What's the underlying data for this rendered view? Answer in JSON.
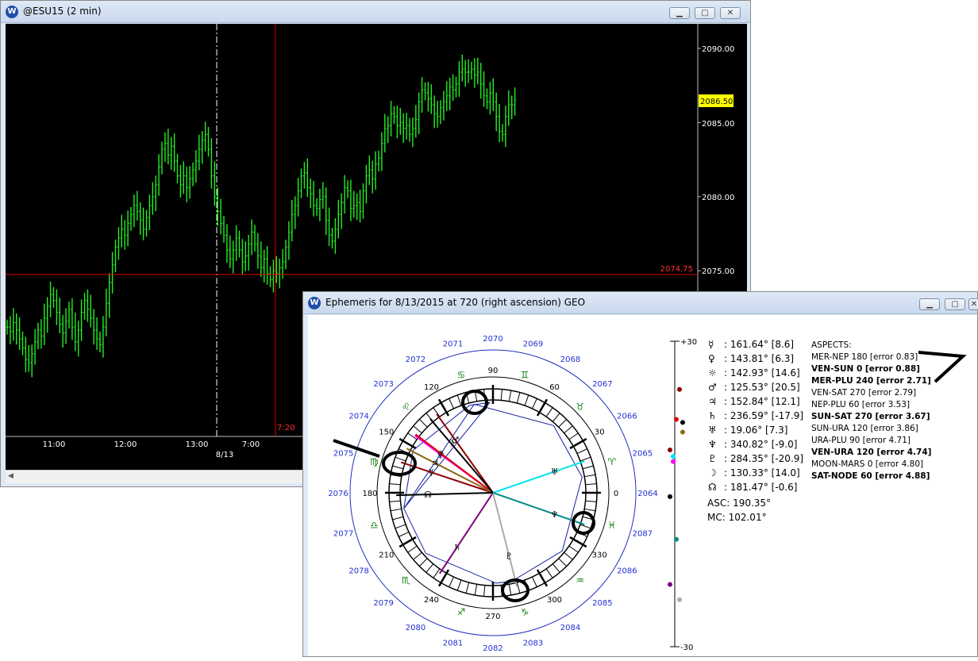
{
  "chart_window": {
    "title": "@ESU15 (2 min)",
    "icon": "w-logo-icon",
    "last_price": "2086.50",
    "crosshair_price": "2074.75",
    "crosshair_time": "7:20",
    "x_ticks": [
      "11:00",
      "12:00",
      "13:00",
      "7:00"
    ],
    "date_label": "8/13",
    "y_ticks": [
      "2090.00",
      "2085.00",
      "2080.00",
      "2075.00"
    ]
  },
  "chart_data": {
    "type": "bar",
    "title": "@ESU15 (2 min)",
    "ylim": [
      2070.0,
      2091.5
    ],
    "y_ticks": [
      2090.0,
      2085.0,
      2080.0,
      2075.0
    ],
    "x_ticks": [
      "11:00",
      "12:00",
      "13:00",
      "7:00"
    ],
    "last_price": 2086.5,
    "crosshair_price": 2074.75,
    "values": [
      2071.2,
      2070.9,
      2071.5,
      2071.0,
      2070.4,
      2069.8,
      2069.0,
      2068.8,
      2069.4,
      2070.2,
      2071.0,
      2070.6,
      2071.8,
      2072.6,
      2073.4,
      2073.0,
      2072.2,
      2071.4,
      2070.8,
      2071.6,
      2072.4,
      2071.2,
      2070.2,
      2071.0,
      2072.2,
      2073.0,
      2072.4,
      2071.8,
      2071.0,
      2070.4,
      2070.0,
      2071.2,
      2072.8,
      2074.2,
      2075.4,
      2076.6,
      2077.2,
      2077.8,
      2077.4,
      2078.2,
      2078.8,
      2079.4,
      2079.0,
      2078.4,
      2077.8,
      2078.6,
      2079.4,
      2080.0,
      2080.8,
      2082.0,
      2083.2,
      2083.6,
      2082.8,
      2083.4,
      2082.4,
      2081.4,
      2080.8,
      2081.4,
      2080.6,
      2081.2,
      2081.8,
      2082.4,
      2083.2,
      2083.8,
      2084.2,
      2083.2,
      2081.4,
      2080.0,
      2079.0,
      2078.2,
      2077.4,
      2076.4,
      2075.8,
      2076.4,
      2077.2,
      2076.4,
      2075.6,
      2076.0,
      2076.8,
      2077.6,
      2076.8,
      2076.0,
      2075.2,
      2075.8,
      2074.8,
      2074.4,
      2075.0,
      2074.8,
      2075.2,
      2075.6,
      2076.6,
      2077.6,
      2078.8,
      2079.4,
      2080.4,
      2081.4,
      2081.6,
      2080.6,
      2080.2,
      2079.4,
      2079.2,
      2079.8,
      2080.0,
      2078.4,
      2077.4,
      2077.0,
      2077.8,
      2078.8,
      2079.6,
      2080.6,
      2080.4,
      2079.2,
      2079.4,
      2079.6,
      2079.0,
      2080.4,
      2081.4,
      2081.8,
      2081.2,
      2082.2,
      2082.6,
      2083.6,
      2084.6,
      2084.8,
      2085.6,
      2085.4,
      2084.8,
      2085.0,
      2084.6,
      2084.8,
      2084.2,
      2084.6,
      2085.2,
      2086.4,
      2087.2,
      2087.0,
      2086.6,
      2086.2,
      2085.6,
      2085.4,
      2086.0,
      2086.4,
      2086.8,
      2087.4,
      2087.2,
      2087.6,
      2088.4,
      2088.6,
      2088.4,
      2088.4,
      2088.6,
      2088.2,
      2088.4,
      2087.6,
      2086.8,
      2086.4,
      2087.0,
      2086.4,
      2085.4,
      2084.4,
      2084.2,
      2085.4,
      2086.2,
      2086.2,
      2086.5
    ]
  },
  "ephemeris_window": {
    "title": "Ephemeris for 8/13/2015 at 720 (right ascension) GEO",
    "icon": "w-logo-icon",
    "wheel": {
      "outer_labels": [
        "2070",
        "2069",
        "2068",
        "2067",
        "2066",
        "2065",
        "2064",
        "2087",
        "2086",
        "2085",
        "2084",
        "2083",
        "2082",
        "2081",
        "2080",
        "2079",
        "2078",
        "2077",
        "2076",
        "2075",
        "2074",
        "2073",
        "2072",
        "2071"
      ],
      "degree_labels": [
        "90",
        "60",
        "30",
        "0",
        "330",
        "300",
        "270",
        "240",
        "210",
        "180",
        "150",
        "120"
      ],
      "sign_glyphs": [
        "♈",
        "♉",
        "♊",
        "♋",
        "♌",
        "♍",
        "♎",
        "♏",
        "♐",
        "♑",
        "♒",
        "♓"
      ]
    },
    "declination_scale": {
      "top": "+30",
      "bottom": "-30"
    },
    "planets": [
      {
        "glyph": "☿",
        "text": ": 161.64° [8.6]",
        "color": "#8b0000",
        "angle": 161.64,
        "decl": 8.6
      },
      {
        "glyph": "♀",
        "text": ": 143.81° [6.3]",
        "color": "#ff00ff",
        "angle": 143.81,
        "decl": 6.3
      },
      {
        "glyph": "☼",
        "text": ": 142.93° [14.6]",
        "color": "#dd0000",
        "angle": 142.93,
        "decl": 14.6
      },
      {
        "glyph": "♂",
        "text": ": 125.53° [20.5]",
        "color": "#8b0000",
        "angle": 125.53,
        "decl": 20.5
      },
      {
        "glyph": "♃",
        "text": ": 152.84° [12.1]",
        "color": "#8b6914",
        "angle": 152.84,
        "decl": 12.1
      },
      {
        "glyph": "♄",
        "text": ": 236.59° [-17.9]",
        "color": "#800080",
        "angle": 236.59,
        "decl": -17.9
      },
      {
        "glyph": "♅",
        "text": ": 19.06° [7.3]",
        "color": "#00e5ee",
        "angle": 19.06,
        "decl": 7.3
      },
      {
        "glyph": "♆",
        "text": ": 340.82° [-9.0]",
        "color": "#008b8b",
        "angle": 340.82,
        "decl": -9.0
      },
      {
        "glyph": "♇",
        "text": ": 284.35° [-20.9]",
        "color": "#aaaaaa",
        "angle": 284.35,
        "decl": -20.9
      },
      {
        "glyph": "☽",
        "text": ": 130.33° [14.0]",
        "color": "#000000",
        "angle": 130.33,
        "decl": 14.0
      },
      {
        "glyph": "☊",
        "text": ": 181.47° [-0.6]",
        "color": "#000000",
        "angle": 181.47,
        "decl": -0.6
      }
    ],
    "asc": "ASC: 190.35°",
    "mc": "MC: 102.01°",
    "aspects_header": "ASPECTS:",
    "aspects": [
      {
        "text": "MER-NEP 180 [error 0.83]",
        "bold": false
      },
      {
        "text": "VEN-SUN 0 [error 0.88]",
        "bold": true
      },
      {
        "text": "MER-PLU 240 [error 2.71]",
        "bold": true
      },
      {
        "text": "VEN-SAT 270 [error 2.79]",
        "bold": false
      },
      {
        "text": "NEP-PLU 60 [error 3.53]",
        "bold": false
      },
      {
        "text": "SUN-SAT 270 [error 3.67]",
        "bold": true
      },
      {
        "text": "SUN-URA 120 [error 3.86]",
        "bold": false
      },
      {
        "text": "URA-PLU 90 [error 4.71]",
        "bold": false
      },
      {
        "text": "VEN-URA 120 [error 4.74]",
        "bold": true
      },
      {
        "text": "MOON-MARS 0 [error 4.80]",
        "bold": false
      },
      {
        "text": "SAT-NODE 60 [error 4.88]",
        "bold": true
      }
    ]
  }
}
